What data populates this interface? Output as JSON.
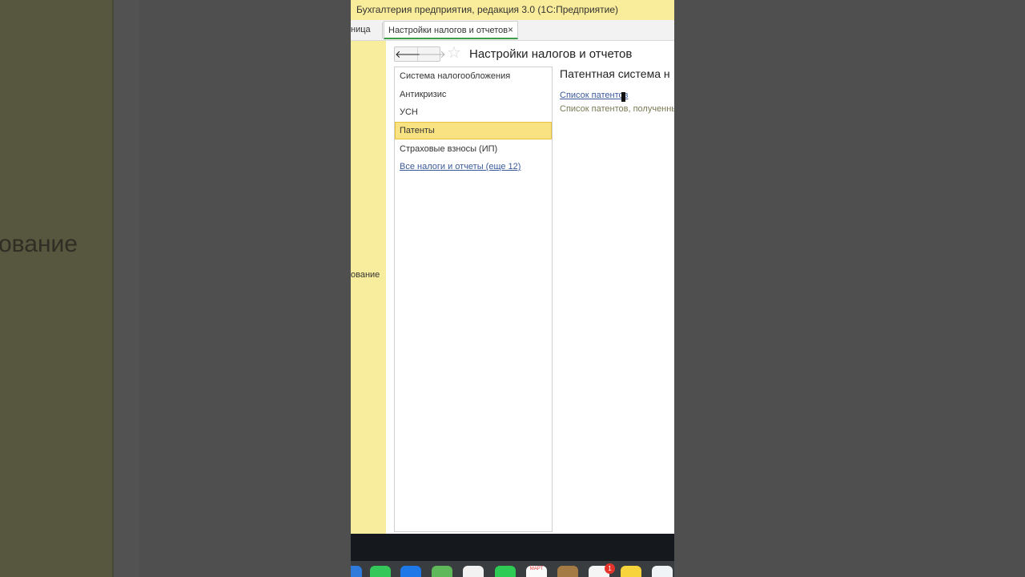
{
  "background": {
    "left_text": "ование"
  },
  "window": {
    "title": "Бухгалтерия предприятия, редакция 3.0  (1С:Предприятие)"
  },
  "tabs": {
    "previous_label": "ница",
    "active_label": "Настройки налогов и отчетов",
    "close_symbol": "×"
  },
  "sidebar": {
    "item_label": "ование"
  },
  "header": {
    "back_symbol": "🡐",
    "forward_symbol": "🡒",
    "star_symbol": "☆",
    "title": "Настройки налогов и отчетов"
  },
  "list": {
    "items": [
      {
        "label": "Система налогообложения"
      },
      {
        "label": "Антикризис"
      },
      {
        "label": "УСН"
      },
      {
        "label": "Патенты"
      },
      {
        "label": "Страховые взносы (ИП)"
      }
    ],
    "selected_index": 3,
    "more_link": "Все налоги и отчеты (еще 12)"
  },
  "panel": {
    "title": "Патентная система н",
    "link": "Список патентов",
    "description": "Список патентов, полученны"
  },
  "dock": {
    "calendar_month": "МАРТ",
    "reminders_badge": "1",
    "icons": [
      "safari-icon",
      "messages-icon",
      "mail-icon",
      "maps-icon",
      "photos-icon",
      "facetime-icon",
      "calendar-icon",
      "contacts-icon",
      "reminders-icon",
      "notes-icon",
      "freeform-icon"
    ]
  },
  "colors": {
    "title_bar": "#f9ec9a",
    "sidebar": "#f8ed9c",
    "selection": "#f9e282",
    "link": "#3b5a9a",
    "active_tab_underline": "#3d9e4a"
  }
}
